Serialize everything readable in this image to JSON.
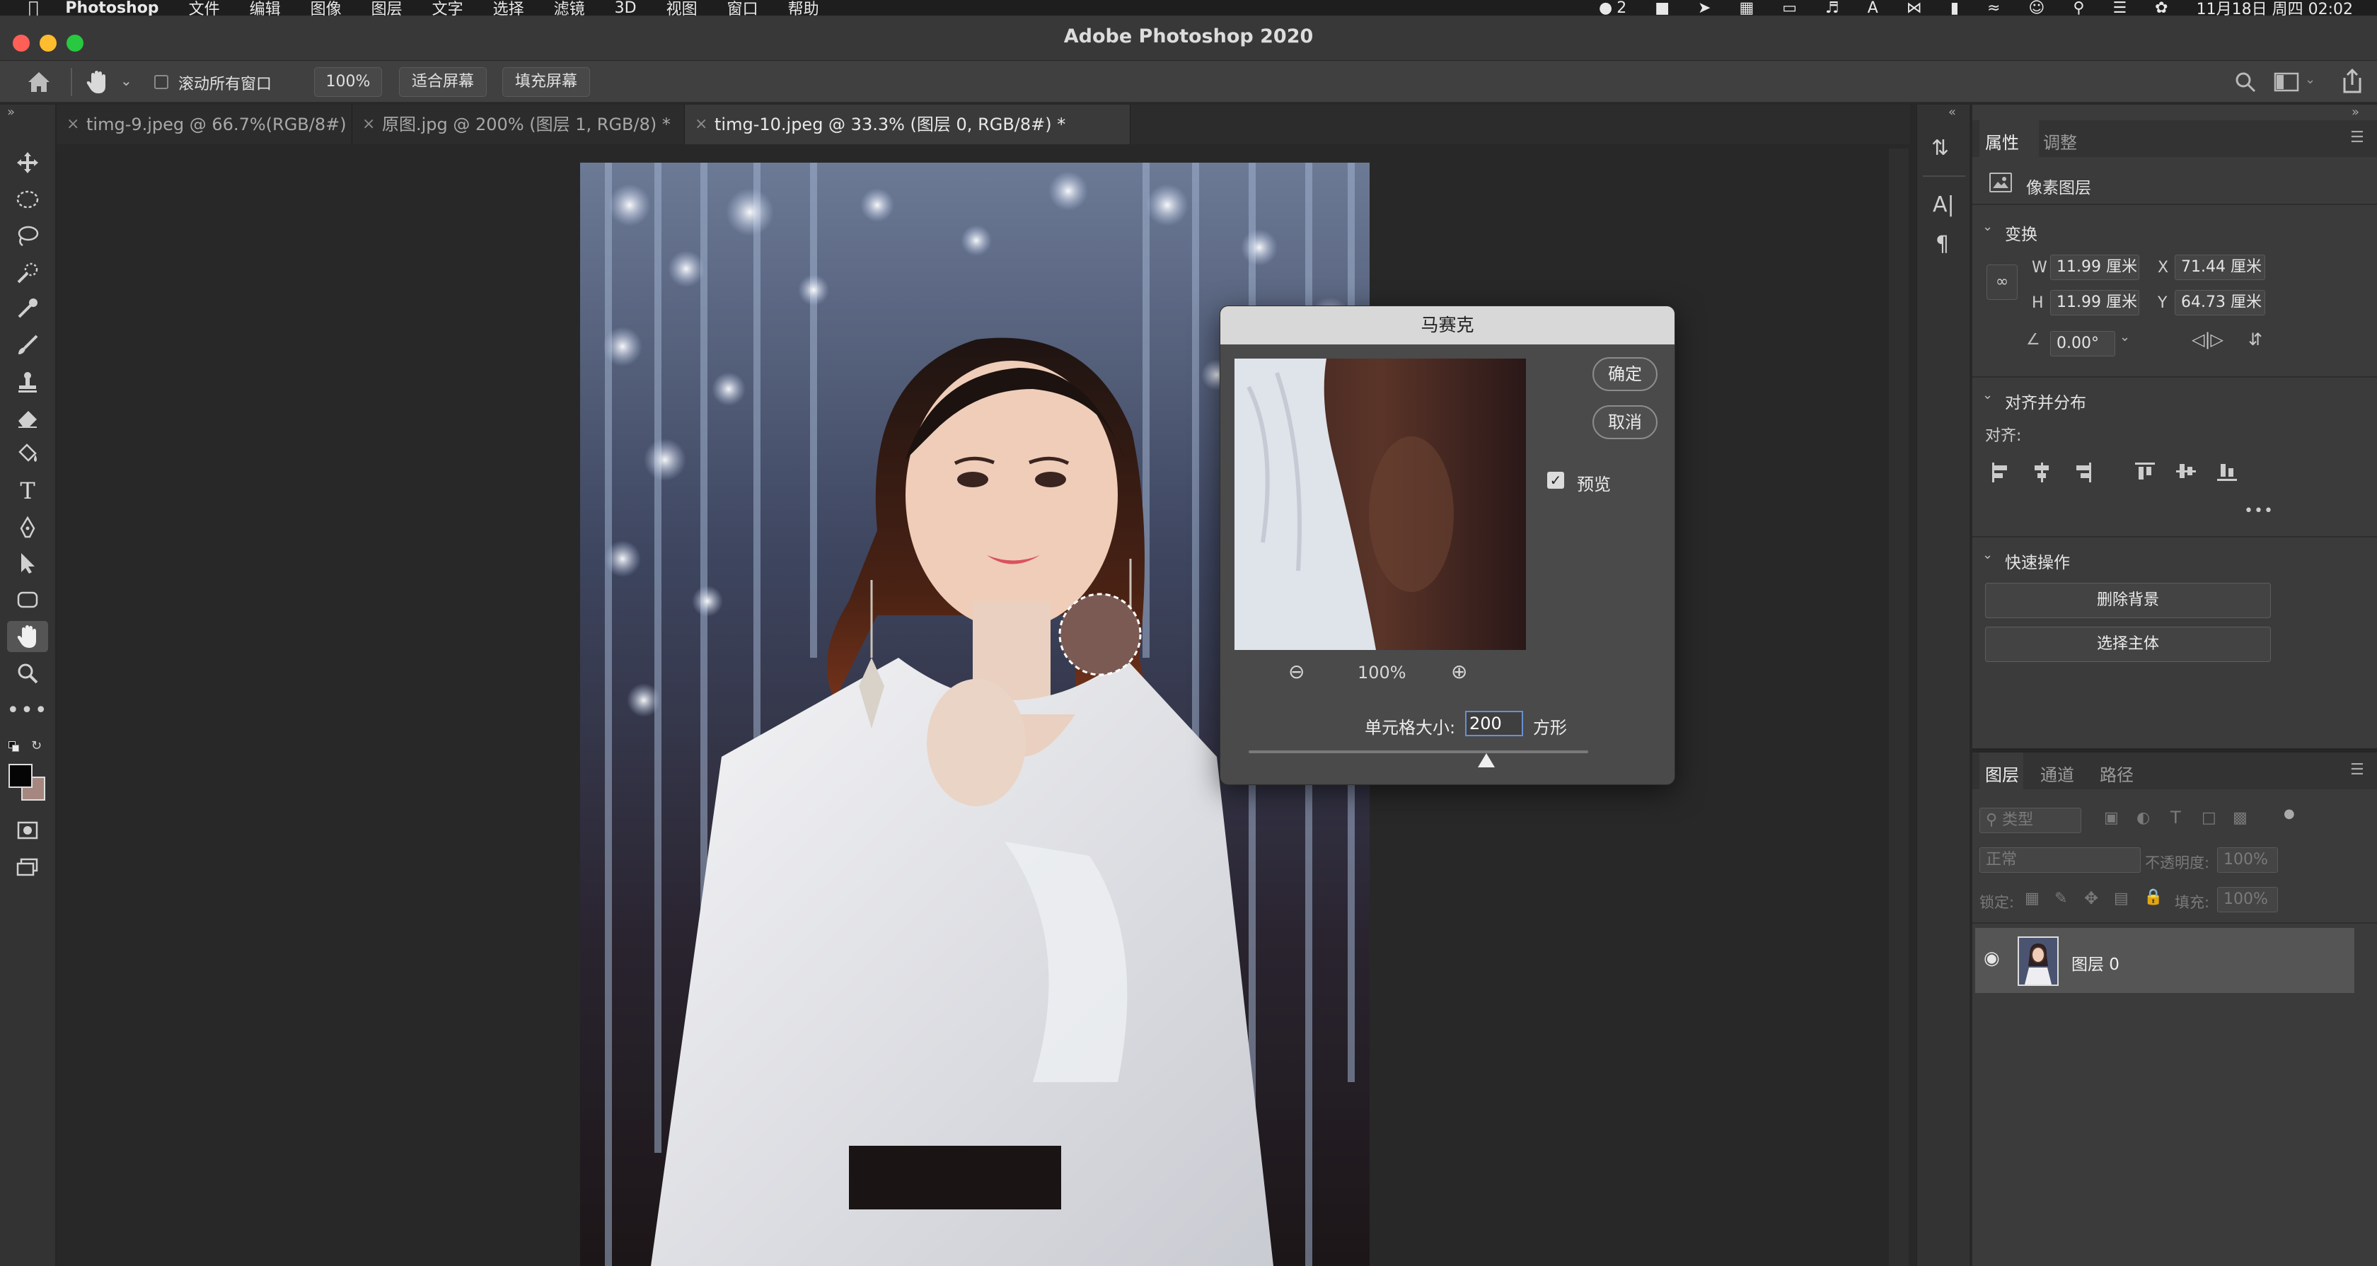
{
  "menubar": {
    "app": "Photoshop",
    "items": [
      "文件",
      "编辑",
      "图像",
      "图层",
      "文字",
      "选择",
      "滤镜",
      "3D",
      "视图",
      "窗口",
      "帮助"
    ],
    "wechat_count": "2",
    "clock": "11月18日 周四 02:02"
  },
  "window": {
    "title": "Adobe Photoshop 2020"
  },
  "options": {
    "scroll_all_label": "滚动所有窗口",
    "zoom_value": "100%",
    "fit_screen": "适合屏幕",
    "fill_screen": "填充屏幕"
  },
  "tabs": [
    {
      "label": "timg-9.jpeg @ 66.7%(RGB/8#)"
    },
    {
      "label": "原图.jpg @ 200% (图层 1, RGB/8) *"
    },
    {
      "label": "timg-10.jpeg @ 33.3% (图层 0, RGB/8#) *"
    }
  ],
  "dialog": {
    "title": "马赛克",
    "ok": "确定",
    "cancel": "取消",
    "preview_label": "预览",
    "zoom": "100%",
    "cell_size_label": "单元格大小:",
    "cell_size_value": "200",
    "unit": "方形",
    "slider_position": 0.7
  },
  "properties": {
    "tab_properties": "属性",
    "tab_adjust": "调整",
    "layer_type": "像素图层",
    "transform_header": "变换",
    "w_label": "W",
    "w_value": "11.99 厘米",
    "h_label": "H",
    "h_value": "11.99 厘米",
    "x_label": "X",
    "x_value": "71.44 厘米",
    "y_label": "Y",
    "y_value": "64.73 厘米",
    "angle_value": "0.00°",
    "align_header": "对齐并分布",
    "align_label": "对齐:",
    "quick_header": "快速操作",
    "remove_bg": "删除背景",
    "select_subject": "选择主体"
  },
  "layers": {
    "tab_layers": "图层",
    "tab_channels": "通道",
    "tab_paths": "路径",
    "filter_placeholder": "类型",
    "blend_mode": "正常",
    "opacity_label": "不透明度:",
    "opacity_value": "100%",
    "lock_label": "锁定:",
    "fill_label": "填充:",
    "fill_value": "100%",
    "layer_name": "图层 0"
  },
  "colors": {
    "accent_highlight": "#1f5fb5",
    "traffic_red": "#ff5f57",
    "traffic_yellow": "#febc2e",
    "traffic_green": "#28c840"
  }
}
